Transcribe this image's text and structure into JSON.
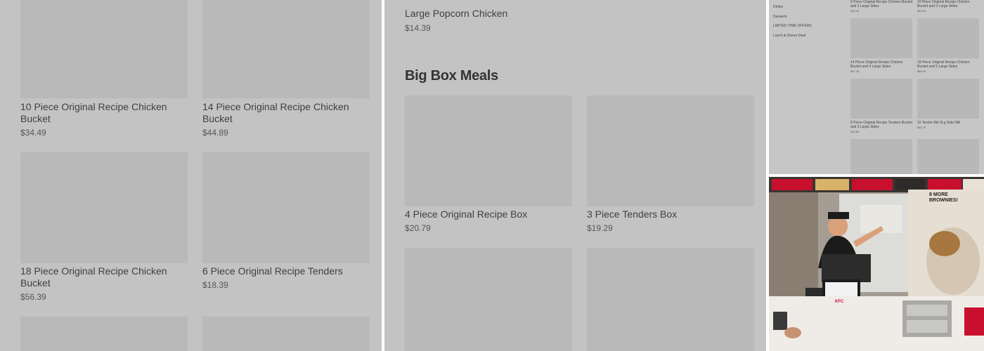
{
  "panel_a": {
    "items": [
      {
        "name": "10 Piece Original Recipe Chicken Bucket",
        "price": "$34.49"
      },
      {
        "name": "14 Piece Original Recipe Chicken Bucket",
        "price": "$44.89"
      },
      {
        "name": "18 Piece Original Recipe Chicken Bucket",
        "price": "$56.39"
      },
      {
        "name": "6 Piece Original Recipe Tenders",
        "price": "$18.39"
      }
    ]
  },
  "panel_b": {
    "top_item": {
      "name": "Large Popcorn Chicken",
      "price": "$14.39"
    },
    "section_title": "Big Box Meals",
    "items": [
      {
        "name": "4 Piece Original Recipe Box",
        "price": "$20.79"
      },
      {
        "name": "3 Piece Tenders Box",
        "price": "$19.29"
      }
    ]
  },
  "panel_c": {
    "sidebar": [
      "Drinks",
      "Desserts",
      "LIMITED TIME OFFERS",
      "Lunch & Dinner Deal"
    ],
    "items": [
      {
        "name": "6 Piece Original Recipe Chicken Bucket and 2 Large Sides",
        "price": "$34.49"
      },
      {
        "name": "10 Piece Original Recipe Chicken Bucket and 3 Large Sides",
        "price": "$45.99"
      },
      {
        "name": "14 Piece Original Recipe Chicken Bucket and 4 Large Sides",
        "price": "$57.49"
      },
      {
        "name": "18 Piece Original Recipe Chicken Bucket and 5 Large Sides",
        "price": "$68.99"
      },
      {
        "name": "6 Piece Original Recipe Tenders Bucket and 2 Large Sides",
        "price": "$29.69"
      },
      {
        "name": "10 Tender Bkt 3Lg Side NM",
        "price": "$40.79"
      }
    ]
  },
  "panel_d": {
    "promo_text": "8 MORE BROWNIES!",
    "kiosk_brand": "KFC"
  },
  "colors": {
    "overlay_gray": "#c3c3c3",
    "thumb_gray": "#b9b9b9",
    "kfc_red": "#c8102e"
  }
}
